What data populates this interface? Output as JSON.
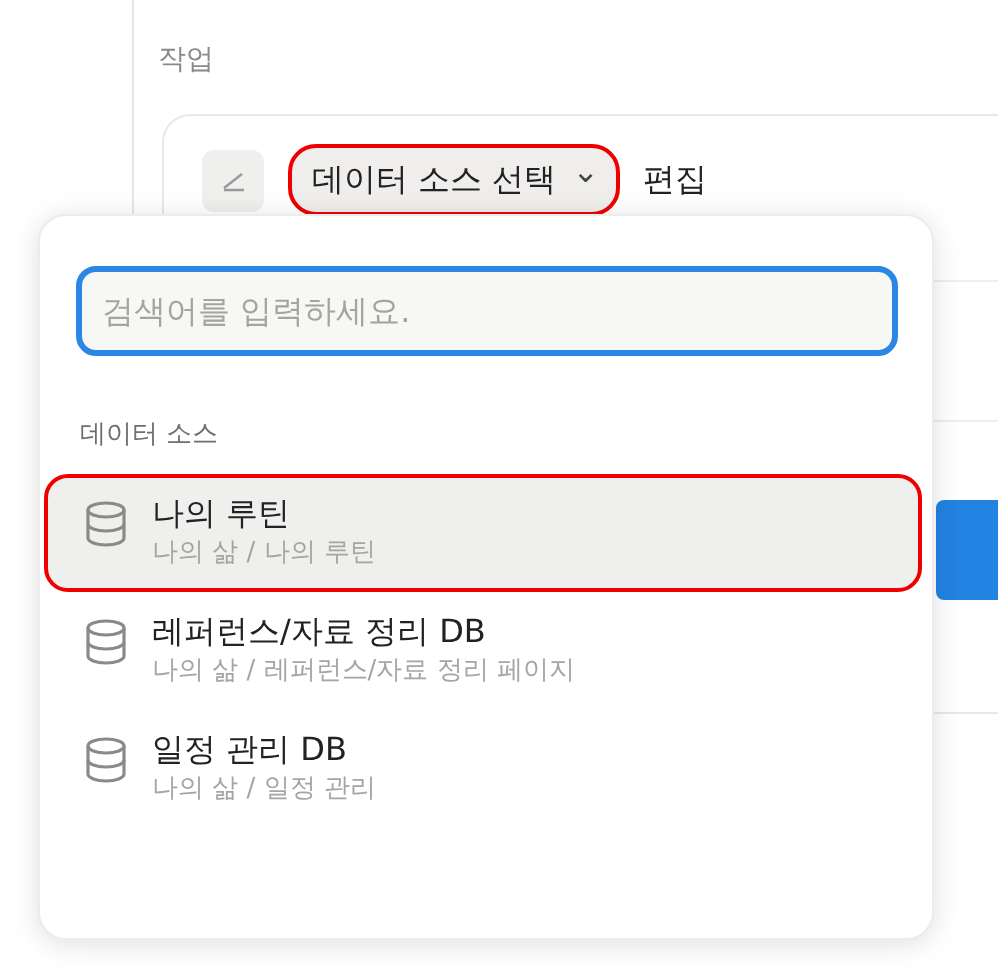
{
  "section_label": "작업",
  "action": {
    "source_button": {
      "label": "데이터 소스 선택",
      "caret": "⌄",
      "annotated": true
    },
    "edit_label": "편집"
  },
  "popup": {
    "search": {
      "placeholder": "검색어를 입력하세요.",
      "focused": true
    },
    "group_label": "데이터 소스",
    "items": [
      {
        "title": "나의 루틴",
        "path": "나의 삶 / 나의 루틴",
        "selected": true,
        "annotated": true
      },
      {
        "title": "레퍼런스/자료 정리 DB",
        "path": "나의 삶 / 레퍼런스/자료 정리 페이지",
        "selected": false,
        "annotated": false
      },
      {
        "title": "일정 관리 DB",
        "path": "나의 삶 / 일정 관리",
        "selected": false,
        "annotated": false
      }
    ]
  }
}
